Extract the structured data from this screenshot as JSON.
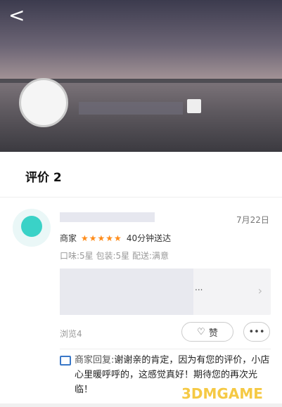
{
  "header": {
    "back_label": "<"
  },
  "tabs": {
    "reviews_label": "评价 2"
  },
  "review": {
    "date": "7月22日",
    "merchant_label": "商家",
    "stars": "★★★★★",
    "delivery": "40分钟送达",
    "ratings": "口味:5星 包装:5星 配送:满意",
    "content_dots": "...",
    "views": "浏览4",
    "like_label": "赞",
    "more_label": "•••"
  },
  "reply": {
    "label": "商家回复:",
    "text": "谢谢亲的肯定，因为有您的评价，小店心里暖呼呼的，这感觉真好！期待您的再次光临！"
  },
  "watermark": "3DMGAME",
  "colors": {
    "star": "#ff8c1a",
    "accent_blue": "#3a78c8",
    "avatar_teal": "#3ad2c7"
  }
}
